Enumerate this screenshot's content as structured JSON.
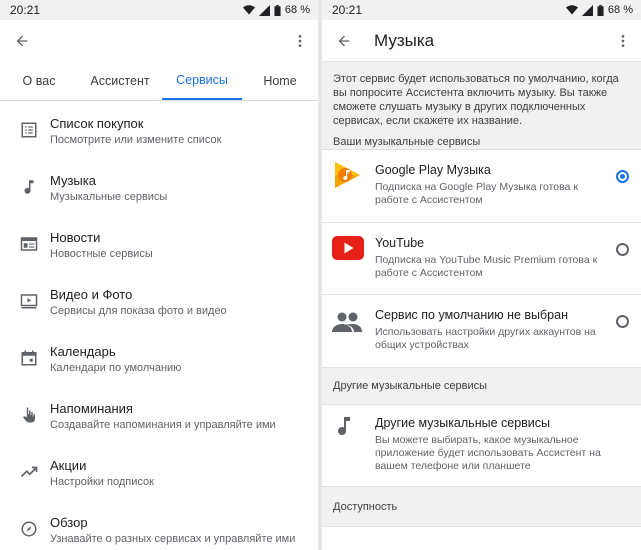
{
  "left": {
    "status": {
      "time": "20:21",
      "battery": "68 %"
    },
    "tabs": [
      {
        "label": "О вас",
        "active": false
      },
      {
        "label": "Ассистент",
        "active": false
      },
      {
        "label": "Сервисы",
        "active": true
      },
      {
        "label": "Home",
        "active": false
      }
    ],
    "items": [
      {
        "icon": "list-icon",
        "title": "Список покупок",
        "subtitle": "Посмотрите или измените список"
      },
      {
        "icon": "music-note-icon",
        "title": "Музыка",
        "subtitle": "Музыкальные сервисы"
      },
      {
        "icon": "news-icon",
        "title": "Новости",
        "subtitle": "Новостные сервисы"
      },
      {
        "icon": "video-icon",
        "title": "Видео и Фото",
        "subtitle": "Сервисы для показа фото и видео"
      },
      {
        "icon": "calendar-icon",
        "title": "Календарь",
        "subtitle": "Календари по умолчанию"
      },
      {
        "icon": "reminder-hand-icon",
        "title": "Напоминания",
        "subtitle": "Создавайте напоминания и управляйте ими"
      },
      {
        "icon": "stocks-icon",
        "title": "Акции",
        "subtitle": "Настройки подписок"
      },
      {
        "icon": "compass-icon",
        "title": "Обзор",
        "subtitle": "Узнавайте о разных сервисах и управляйте ими"
      }
    ]
  },
  "right": {
    "status": {
      "time": "20:21",
      "battery": "68 %"
    },
    "title": "Музыка",
    "description": "Этот сервис будет использоваться по умолчанию, когда вы попросите Ассистента включить музыку. Вы также сможете слушать музыку в других подключенных сервисах, если скажете их название.",
    "your_services_header": "Ваши музыкальные сервисы",
    "services": [
      {
        "icon": "google-play-music-icon",
        "name": "Google Play Музыка",
        "subtitle": "Подписка на Google Play Музыка готова к работе с Ассистентом",
        "selected": true
      },
      {
        "icon": "youtube-icon",
        "name": "YouTube",
        "subtitle": "Подписка на YouTube Music Premium готова к работе с Ассистентом",
        "selected": false
      },
      {
        "icon": "people-icon",
        "name": "Сервис по умолчанию не выбран",
        "subtitle": "Использовать настройки других аккаунтов на общих устройствах",
        "selected": false
      }
    ],
    "other_header": "Другие музыкальные сервисы",
    "other": {
      "icon": "music-note-icon",
      "name": "Другие музыкальные сервисы",
      "subtitle": "Вы можете выбирать, какое музыкальное приложение будет использовать Ассистент на вашем телефоне или планшете"
    },
    "accessibility_header": "Доступность"
  },
  "colors": {
    "accent": "#1a73e8",
    "youtube_red": "#e62117",
    "gpm_orange": "#f4a300"
  }
}
